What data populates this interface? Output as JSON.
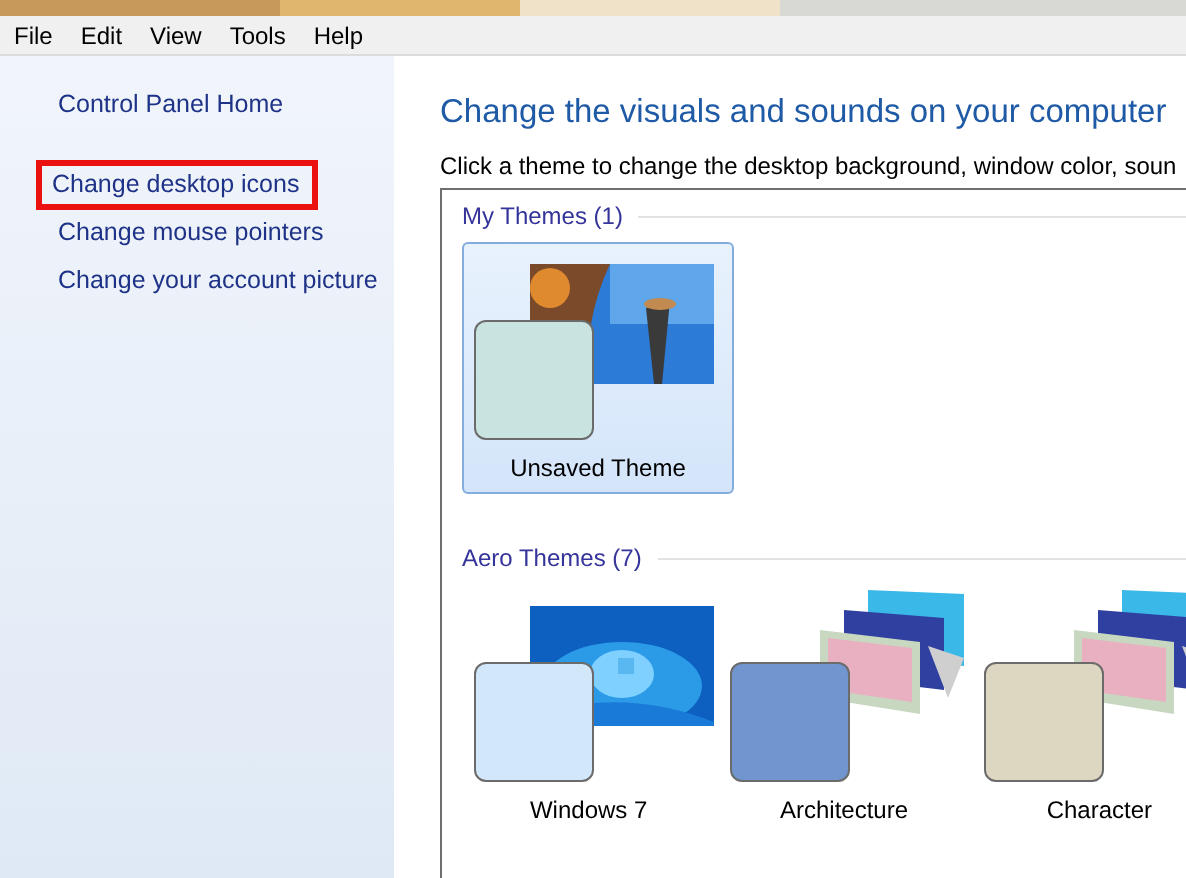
{
  "menu_bar": [
    "File",
    "Edit",
    "View",
    "Tools",
    "Help"
  ],
  "sidebar": {
    "items": [
      {
        "label": "Control Panel Home",
        "highlighted": false
      },
      {
        "label": "Change desktop icons",
        "highlighted": true
      },
      {
        "label": "Change mouse pointers",
        "highlighted": false
      },
      {
        "label": "Change your account picture",
        "highlighted": false
      }
    ]
  },
  "heading": "Change the visuals and sounds on your computer",
  "description": "Click a theme to change the desktop background, window color, soun",
  "groups": [
    {
      "title": "My Themes (1)",
      "themes": [
        {
          "name": "Unsaved Theme",
          "selected": true,
          "color": "#c9e3e0",
          "kind": "single"
        }
      ]
    },
    {
      "title": "Aero Themes (7)",
      "themes": [
        {
          "name": "Windows 7",
          "selected": false,
          "color": "#d3e7fa",
          "kind": "single"
        },
        {
          "name": "Architecture",
          "selected": false,
          "color": "#7196cf",
          "kind": "stack"
        },
        {
          "name": "Character",
          "selected": false,
          "color": "#ddd6c0",
          "kind": "stack"
        }
      ]
    }
  ]
}
